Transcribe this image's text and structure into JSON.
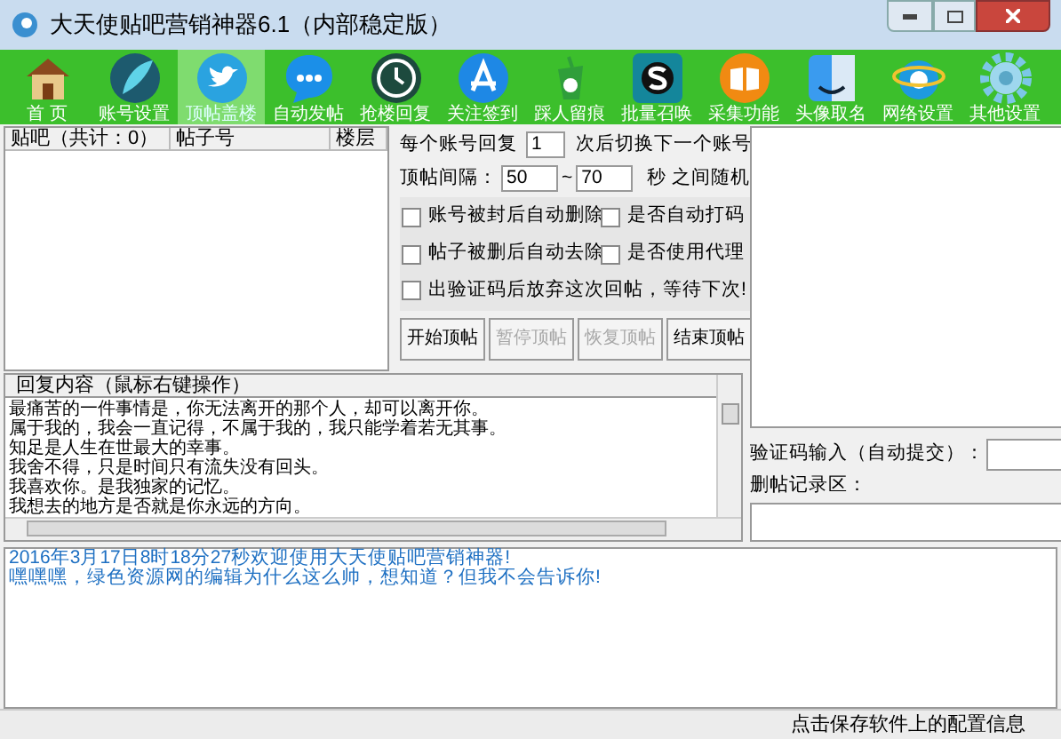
{
  "window": {
    "title": "大天使贴吧营销神器6.1（内部稳定版）"
  },
  "toolbar": [
    {
      "kind": "house",
      "label": "首 页",
      "selected": false
    },
    {
      "kind": "feather",
      "label": "账号设置",
      "selected": false
    },
    {
      "kind": "bird",
      "label": "顶帖盖楼",
      "selected": true
    },
    {
      "kind": "chat",
      "label": "自动发帖",
      "selected": false
    },
    {
      "kind": "clock",
      "label": "抢楼回复",
      "selected": false
    },
    {
      "kind": "store",
      "label": "关注签到",
      "selected": false
    },
    {
      "kind": "cup",
      "label": "踩人留痕",
      "selected": false
    },
    {
      "kind": "skype",
      "label": "批量召唤",
      "selected": false
    },
    {
      "kind": "book",
      "label": "采集功能",
      "selected": false
    },
    {
      "kind": "face",
      "label": "头像取名",
      "selected": false
    },
    {
      "kind": "globe",
      "label": "网络设置",
      "selected": false
    },
    {
      "kind": "gear",
      "label": "其他设置",
      "selected": false
    }
  ],
  "table": {
    "columns": [
      "贴吧（共计：0）",
      "帖子号",
      "楼层"
    ]
  },
  "settings": {
    "per_account_prefix": "每个账号回复",
    "per_account_value": "1",
    "per_account_suffix": "次后切换下一个账号",
    "interval_label": "顶帖间隔：",
    "interval_min": "50",
    "interval_sep": "~",
    "interval_max": "70",
    "interval_suffix": "秒 之间随机",
    "checkboxes": [
      {
        "label": "账号被封后自动删除",
        "checked": false
      },
      {
        "label": "是否自动打码",
        "checked": false
      },
      {
        "label": "帖子被删后自动去除",
        "checked": false
      },
      {
        "label": "是否使用代理",
        "checked": false
      },
      {
        "label": "出验证码后放弃这次回帖，等待下次!",
        "checked": false
      }
    ],
    "buttons": [
      {
        "label": "开始顶帖",
        "disabled": false
      },
      {
        "label": "暂停顶帖",
        "disabled": true
      },
      {
        "label": "恢复顶帖",
        "disabled": true
      },
      {
        "label": "结束顶帖",
        "disabled": false
      }
    ]
  },
  "reply": {
    "title": "回复内容（鼠标右键操作）",
    "lines": [
      "最痛苦的一件事情是，你无法离开的那个人，却可以离开你。",
      "属于我的，我会一直记得，不属于我的，我只能学着若无其事。",
      "知足是人生在世最大的幸事。",
      "我舍不得，只是时间只有流失没有回头。",
      "我喜欢你。是我独家的记忆。",
      "我想去的地方是否就是你永远的方向。"
    ]
  },
  "captcha": {
    "label": "验证码输入（自动提交）：",
    "delete_log_label": "删帖记录区："
  },
  "log": [
    "2016年3月17日8时18分27秒欢迎使用大天使贴吧营销神器!",
    "嘿嘿嘿，绿色资源网的编辑为什么这么帅，想知道？但我不会告诉你!"
  ],
  "status_bar": {
    "text": "点击保存软件上的配置信息"
  }
}
